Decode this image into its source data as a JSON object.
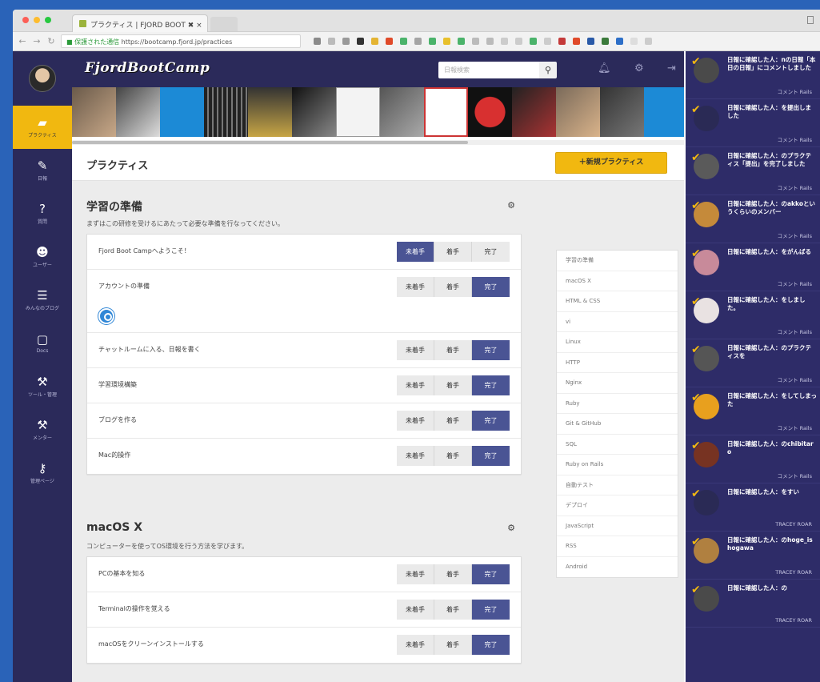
{
  "browser": {
    "tab_title": "プラクティス | FJORD BOOT ✖ ×",
    "url_secure_label": "保護された通信",
    "url": "https://bootcamp.fjord.jp/practices"
  },
  "header": {
    "logo": "FjordBootCamp",
    "search_placeholder": "日報検索",
    "search_icon": "search-icon",
    "icons": [
      "bell-icon",
      "gear-icon",
      "logout-icon"
    ]
  },
  "nav": {
    "items": [
      {
        "name": "practices",
        "icon": "book-icon",
        "glyph": "▰",
        "label": "プラクティス",
        "active": true
      },
      {
        "name": "reports",
        "icon": "pencil-icon",
        "glyph": "✎",
        "label": "日報",
        "active": false
      },
      {
        "name": "questions",
        "icon": "question-icon",
        "glyph": "?",
        "label": "質問",
        "active": false
      },
      {
        "name": "users",
        "icon": "users-icon",
        "glyph": "☻",
        "label": "ユーザー",
        "active": false
      },
      {
        "name": "everyones-blog",
        "icon": "rss-icon",
        "glyph": "☰",
        "label": "みんなのブログ",
        "active": false
      },
      {
        "name": "docs",
        "icon": "file-icon",
        "glyph": "▢",
        "label": "Docs",
        "active": false
      },
      {
        "name": "admin",
        "icon": "wrench-icon",
        "glyph": "⚒",
        "label": "ツール・管理",
        "active": false
      },
      {
        "name": "mentor",
        "icon": "wrench-icon",
        "glyph": "⚒",
        "label": "メンター",
        "active": false
      },
      {
        "name": "dashboard",
        "icon": "key-icon",
        "glyph": "⚷",
        "label": "管理ページ",
        "active": false
      }
    ]
  },
  "page": {
    "title": "プラクティス",
    "new_practice_button": "＋新規プラクティス"
  },
  "categories": [
    {
      "title": "学習の準備",
      "description": "まずはこの研修を受けるにあたって必要な準備を行なってください。",
      "practices": [
        {
          "name": "Fjord Boot Campへようこそ！",
          "status": "unstarted",
          "mark": false
        },
        {
          "name": "アカウントの準備",
          "status": "complete",
          "mark": true
        },
        {
          "name": "チャットルームに入る、日報を書く",
          "status": "complete",
          "mark": false
        },
        {
          "name": "学習環境構築",
          "status": "complete",
          "mark": false
        },
        {
          "name": "ブログを作る",
          "status": "complete",
          "mark": false
        },
        {
          "name": "Mac的操作",
          "status": "complete",
          "mark": false
        }
      ]
    },
    {
      "title": "macOS X",
      "description": "コンピューターを使ってOS環境を行う方法を学びます。",
      "practices": [
        {
          "name": "PCの基本を知る",
          "status": "complete",
          "mark": false
        },
        {
          "name": "Terminalの操作を覚える",
          "status": "complete",
          "mark": false
        },
        {
          "name": "macOSをクリーンインストールする",
          "status": "complete",
          "mark": false
        }
      ]
    }
  ],
  "status_labels": {
    "unstarted": "未着手",
    "started": "着手",
    "complete": "完了"
  },
  "side_menu": [
    "学習の準備",
    "macOS X",
    "HTML & CSS",
    "vi",
    "Linux",
    "HTTP",
    "Nginx",
    "Ruby",
    "Git & GitHub",
    "SQL",
    "Ruby on Rails",
    "自動テスト",
    "デプロイ",
    "JavaScript",
    "RSS",
    "Android"
  ],
  "feed": [
    {
      "text": "日報に確認した人：nの日報「本日の日報」にコメントしました",
      "author": "コメント Rails",
      "avatar": "#4a4a4a"
    },
    {
      "text": "日報に確認した人：を提出しました",
      "author": "コメント Rails",
      "avatar": "#2a2a55"
    },
    {
      "text": "日報に確認した人：のプラクティス「提出」を完了しました",
      "author": "コメント Rails",
      "avatar": "#5a5a5a"
    },
    {
      "text": "日報に確認した人：のakkoというくらいのメンバー",
      "author": "コメント Rails",
      "avatar": "#c58a3a"
    },
    {
      "text": "日報に確認した人：をがんばる",
      "author": "コメント Rails",
      "avatar": "#c88a9a"
    },
    {
      "text": "日報に確認した人：をしました。",
      "author": "コメント Rails",
      "avatar": "#e9e2e2"
    },
    {
      "text": "日報に確認した人：のプラクティスを",
      "author": "コメント Rails",
      "avatar": "#555"
    },
    {
      "text": "日報に確認した人：をしてしまった",
      "author": "コメント Rails",
      "avatar": "#e8a01e"
    },
    {
      "text": "日報に確認した人：のchibitaro",
      "author": "コメント Rails",
      "avatar": "#773322"
    },
    {
      "text": "日報に確認した人：をすい",
      "author": "TRACEY ROAR",
      "avatar": "#2a2a55"
    },
    {
      "text": "日報に確認した人：のhoge_ishogawa",
      "author": "TRACEY ROAR",
      "avatar": "#b08040"
    },
    {
      "text": "日報に確認した人：の",
      "author": "TRACEY ROAR",
      "avatar": "#4a4a4a"
    }
  ],
  "colors": {
    "accent": "#f1b810",
    "nav_bg": "#2b2a5a",
    "status_on": "#4a5494",
    "feed_bg": "#2e2c68"
  }
}
